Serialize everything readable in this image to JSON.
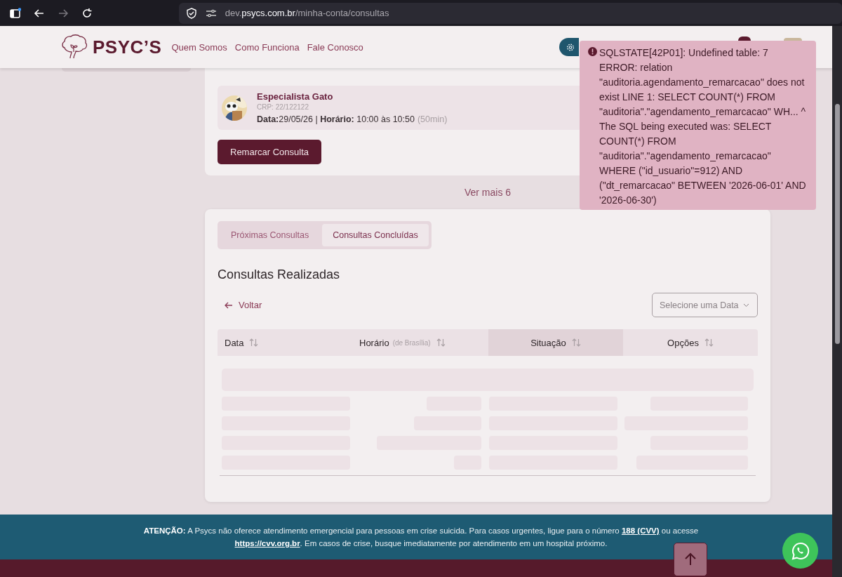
{
  "browser": {
    "url": "dev.**psycs.com.br**/minha-conta/consultas"
  },
  "header": {
    "brand": "PSYC’S",
    "nav": [
      "Quem Somos",
      "Como Funciona",
      "Fale Conosco"
    ]
  },
  "appointment": {
    "name": "Especialista Gato",
    "crp": "CRP: 22/122122",
    "detail": "**Data:**29/05/26 | **Horário:** 10:00 às 10:50",
    "duration": "(50min)",
    "action": "Remarcar Consulta"
  },
  "see_more": "Ver mais 6",
  "history": {
    "tabs": [
      {
        "label": "Próximas Consultas",
        "selected": false
      },
      {
        "label": "Consultas Concluídas",
        "selected": true
      }
    ],
    "title": "Consultas Realizadas",
    "back": "Voltar",
    "date_select": {
      "placeholder": "Selecione uma Data"
    },
    "columns": [
      {
        "label": "Data",
        "selected": false
      },
      {
        "label": "Horário",
        "note": "(de Brasília)",
        "selected": false
      },
      {
        "label": "Situação",
        "selected": true
      },
      {
        "label": "Opções",
        "selected": false
      }
    ]
  },
  "notice": [
    {
      "kind": "strong",
      "text": "ATENÇÃO:"
    },
    {
      "kind": "text",
      "text": " A Psycs não oferece atendimento emergencial para pessoas em crise suicida. Para casos urgentes, ligue para o número "
    },
    {
      "kind": "link",
      "text": "188 (CVV)"
    },
    {
      "kind": "text",
      "text": " ou acesse "
    },
    {
      "kind": "link",
      "text": "https://cvv.org.br"
    },
    {
      "kind": "text",
      "text": ". Em casos de crise, busque imediatamente por atendimento em um hospital próximo."
    }
  ],
  "error_toast": {
    "message": "SQLSTATE[42P01]: Undefined table: 7 ERROR: relation \"auditoria.agendamento_remarcacao\" does not exist LINE 1: SELECT COUNT(*) FROM \"auditoria\".\"agendamento_remarcacao\" WH... ^ The SQL being executed was: SELECT COUNT(*) FROM \"auditoria\".\"agendamento_remarcacao\" WHERE (\"id_usuario\"=912) AND (\"dt_remarcacao\" BETWEEN '2026-06-01' AND '2026-06-30')"
  }
}
